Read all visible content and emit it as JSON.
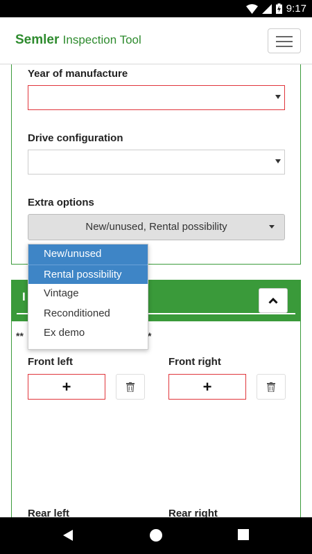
{
  "status_bar": {
    "time": "9:17"
  },
  "header": {
    "brand_bold": "Semler",
    "brand_rest": "Inspection Tool"
  },
  "form": {
    "year_label": "Year of manufacture",
    "year_value": "",
    "drive_label": "Drive configuration",
    "drive_value": "",
    "extra_label": "Extra options",
    "extra_value": "New/unused, Rental possibility"
  },
  "dropdown": {
    "items": [
      {
        "label": "New/unused",
        "selected": true
      },
      {
        "label": "Rental possibility",
        "selected": true
      },
      {
        "label": "Vintage",
        "selected": false
      },
      {
        "label": "Reconditioned",
        "selected": false
      },
      {
        "label": "Ex demo",
        "selected": false
      }
    ]
  },
  "photos": {
    "section_initial": "I",
    "stars_left": "**",
    "stars_right": "*",
    "front_left_label": "Front left",
    "front_right_label": "Front right",
    "rear_left_label": "Rear left",
    "rear_right_label": "Rear right",
    "add_symbol": "+"
  },
  "colors": {
    "brand_green": "#2e8b2e",
    "accent_green": "#3a9a3a",
    "error_red": "#e0343a",
    "select_blue": "#3e85c6"
  }
}
